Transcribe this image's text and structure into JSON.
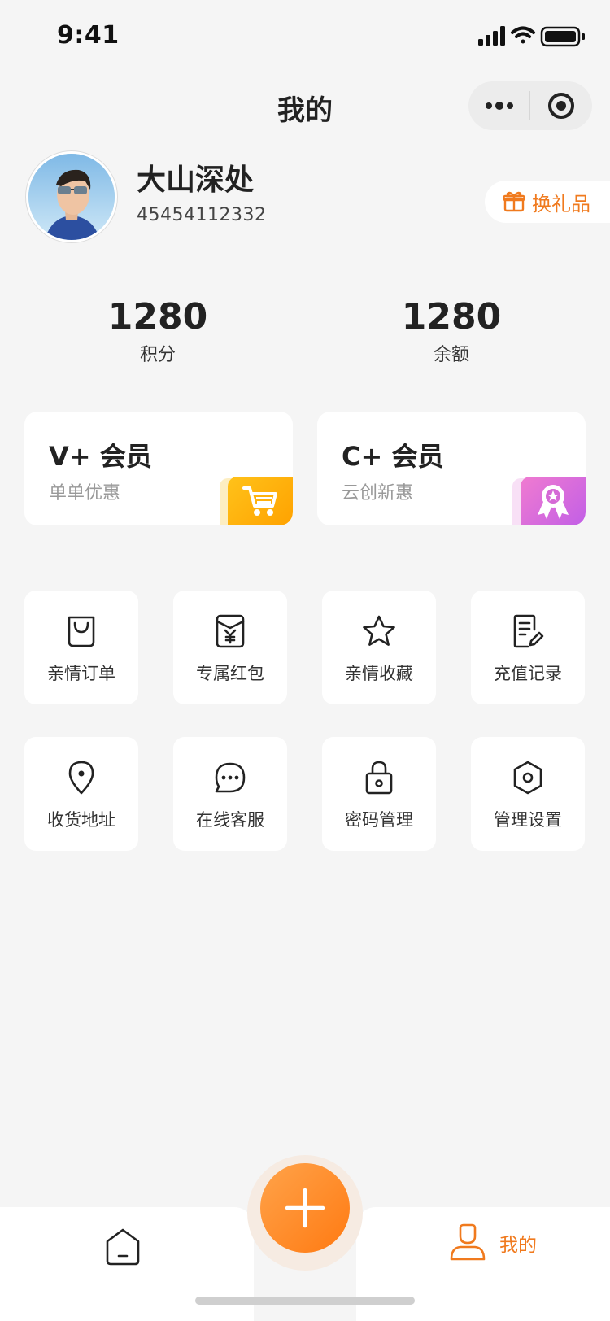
{
  "status_bar": {
    "time": "9:41"
  },
  "nav": {
    "title": "我的"
  },
  "profile": {
    "name": "大山深处",
    "id": "45454112332",
    "gift_button_label": "换礼品"
  },
  "stats": [
    {
      "value": "1280",
      "label": "积分"
    },
    {
      "value": "1280",
      "label": "余额"
    }
  ],
  "member_cards": [
    {
      "title": "V+ 会员",
      "subtitle": "单单优惠",
      "icon": "shopping-cart-icon",
      "color": "#ffb400"
    },
    {
      "title": "C+ 会员",
      "subtitle": "云创新惠",
      "icon": "award-ribbon-icon",
      "color": "#d86be0"
    }
  ],
  "menu": [
    {
      "label": "亲情订单",
      "icon": "shopping-bag-icon"
    },
    {
      "label": "专属红包",
      "icon": "red-envelope-icon"
    },
    {
      "label": "亲情收藏",
      "icon": "star-icon"
    },
    {
      "label": "充值记录",
      "icon": "document-edit-icon"
    },
    {
      "label": "收货地址",
      "icon": "location-pin-icon"
    },
    {
      "label": "在线客服",
      "icon": "chat-bubble-icon"
    },
    {
      "label": "密码管理",
      "icon": "lock-icon"
    },
    {
      "label": "管理设置",
      "icon": "settings-hexagon-icon"
    }
  ],
  "tabbar": {
    "home_icon": "home-icon",
    "add_icon": "plus-icon",
    "mine_label": "我的",
    "mine_icon": "user-icon"
  },
  "colors": {
    "accent": "#f07a1e",
    "background": "#f5f5f5"
  }
}
